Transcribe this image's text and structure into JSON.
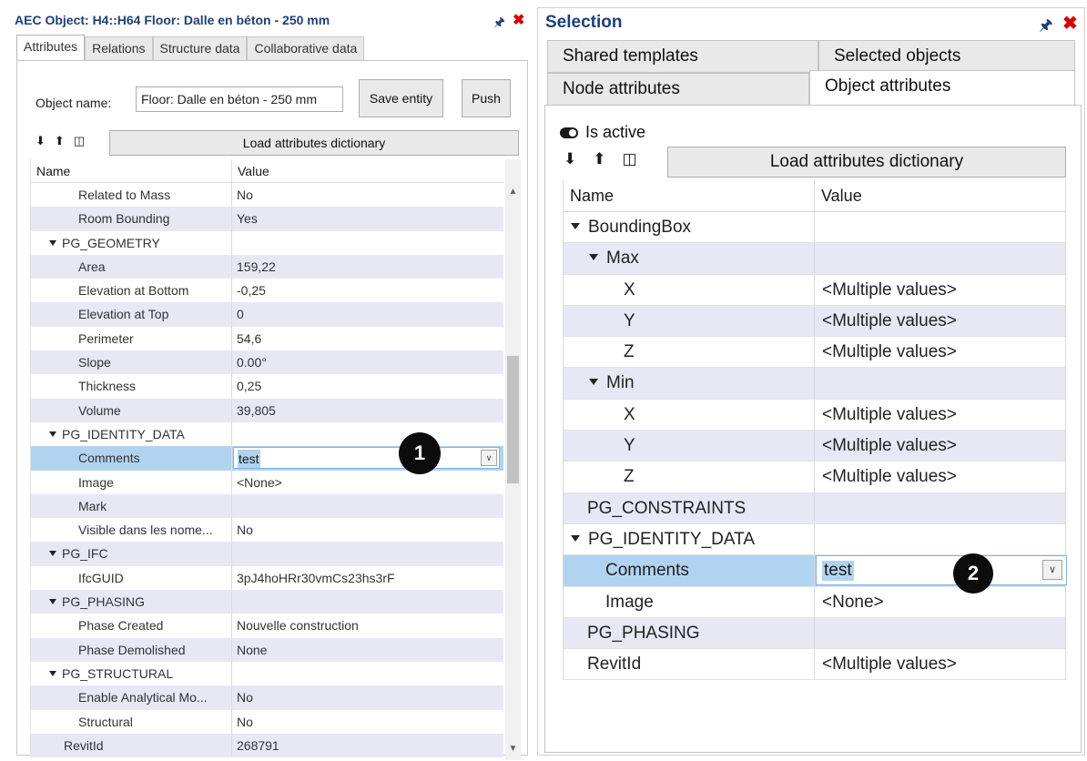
{
  "left_panel": {
    "title": "AEC Object: H4::H64 Floor: Dalle en béton - 250 mm",
    "tabs": [
      "Attributes",
      "Relations",
      "Structure data",
      "Collaborative data"
    ],
    "object_name_label": "Object name:",
    "object_name_value": "Floor: Dalle en béton - 250 mm",
    "save_button": "Save entity",
    "push_button": "Push",
    "load_dict_button": "Load attributes dictionary",
    "grid_headers": {
      "name": "Name",
      "value": "Value"
    },
    "rows": [
      {
        "name": "Related to Mass",
        "value": "No"
      },
      {
        "name": "Room Bounding",
        "value": "Yes"
      },
      {
        "name": "PG_GEOMETRY",
        "value": ""
      },
      {
        "name": "Area",
        "value": "159,22"
      },
      {
        "name": "Elevation at Bottom",
        "value": "-0,25"
      },
      {
        "name": "Elevation at Top",
        "value": "0"
      },
      {
        "name": "Perimeter",
        "value": "54,6"
      },
      {
        "name": "Slope",
        "value": "0.00°"
      },
      {
        "name": "Thickness",
        "value": "0,25"
      },
      {
        "name": "Volume",
        "value": "39,805"
      },
      {
        "name": "PG_IDENTITY_DATA",
        "value": ""
      },
      {
        "name": "Comments",
        "value": "test"
      },
      {
        "name": "Image",
        "value": "<None>"
      },
      {
        "name": "Mark",
        "value": ""
      },
      {
        "name": "Visible dans les nome...",
        "value": "No"
      },
      {
        "name": "PG_IFC",
        "value": ""
      },
      {
        "name": "IfcGUID",
        "value": "3pJ4hoHRr30vmCs23hs3rF"
      },
      {
        "name": "PG_PHASING",
        "value": ""
      },
      {
        "name": "Phase Created",
        "value": "Nouvelle construction"
      },
      {
        "name": "Phase Demolished",
        "value": "None"
      },
      {
        "name": "PG_STRUCTURAL",
        "value": ""
      },
      {
        "name": "Enable Analytical Mo...",
        "value": "No"
      },
      {
        "name": "Structural",
        "value": "No"
      },
      {
        "name": "RevitId",
        "value": "268791"
      }
    ],
    "badge": "1"
  },
  "right_panel": {
    "title": "Selection",
    "tabs_top": [
      "Shared templates",
      "Selected objects"
    ],
    "tabs_bottom": [
      "Node attributes",
      "Object attributes"
    ],
    "is_active_label": "Is active",
    "load_dict_button": "Load attributes dictionary",
    "grid_headers": {
      "name": "Name",
      "value": "Value"
    },
    "rows": [
      {
        "name": "BoundingBox",
        "value": ""
      },
      {
        "name": "Max",
        "value": ""
      },
      {
        "name": "X",
        "value": "<Multiple values>"
      },
      {
        "name": "Y",
        "value": "<Multiple values>"
      },
      {
        "name": "Z",
        "value": "<Multiple values>"
      },
      {
        "name": "Min",
        "value": ""
      },
      {
        "name": "X",
        "value": "<Multiple values>"
      },
      {
        "name": "Y",
        "value": "<Multiple values>"
      },
      {
        "name": "Z",
        "value": "<Multiple values>"
      },
      {
        "name": "PG_CONSTRAINTS",
        "value": ""
      },
      {
        "name": "PG_IDENTITY_DATA",
        "value": ""
      },
      {
        "name": "Comments",
        "value": "test"
      },
      {
        "name": "Image",
        "value": "<None>"
      },
      {
        "name": "PG_PHASING",
        "value": ""
      },
      {
        "name": "RevitId",
        "value": "<Multiple values>"
      }
    ],
    "badge": "2"
  },
  "icons": {
    "pin": "pin-icon",
    "close": "close-icon",
    "expand_all": "expand-all-icon",
    "collapse_all": "collapse-all-icon",
    "columns": "columns-icon",
    "toggle": "toggle-icon",
    "dropdown": "chevron-down-icon"
  },
  "colors": {
    "title": "#1f3f7a",
    "close": "#d40000",
    "alt_row": "#e8e8f5",
    "selected_row": "#b2d3ef"
  }
}
